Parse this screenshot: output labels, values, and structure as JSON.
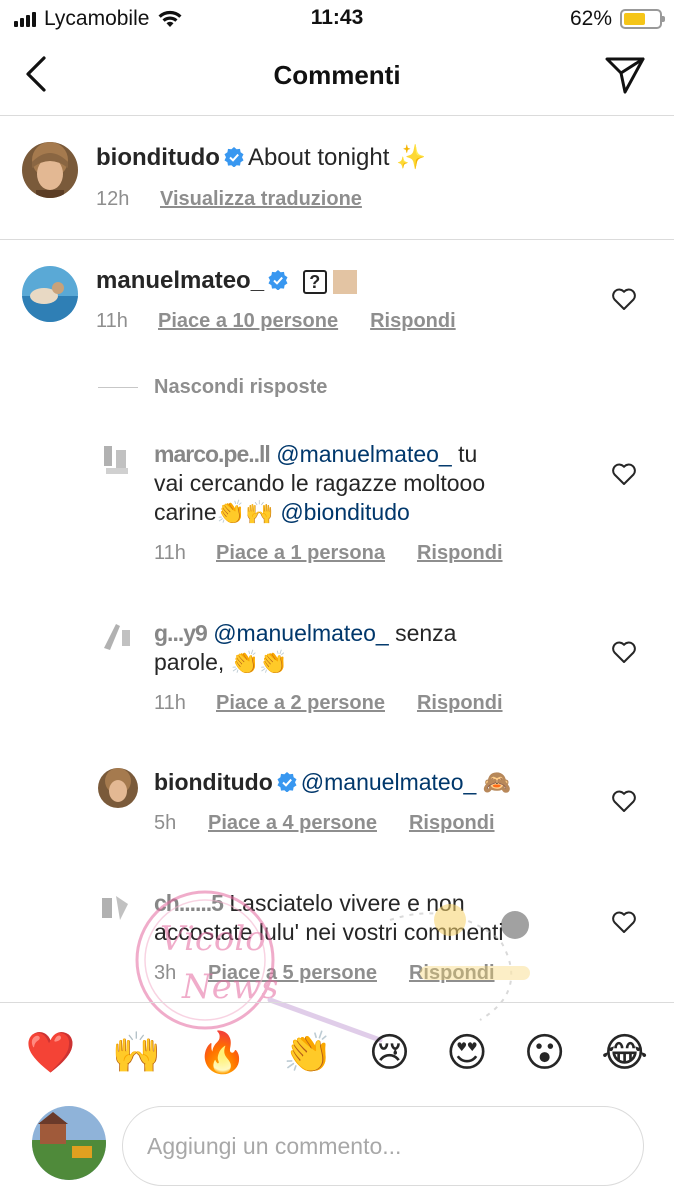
{
  "status_bar": {
    "carrier": "Lycamobile",
    "time": "11:43",
    "battery": "62%",
    "battery_level": 0.62
  },
  "header": {
    "title": "Commenti",
    "back_icon": "chevron-left-icon",
    "send_icon": "paper-plane-icon"
  },
  "caption": {
    "username": "bionditudo",
    "text": "About tonight ✨",
    "time": "12h",
    "translate_label": "Visualizza traduzione"
  },
  "comment": {
    "username": "manuelmateo_",
    "text": "❓",
    "time": "11h",
    "likes_label": "Piace a 10 persone",
    "reply_label": "Rispondi"
  },
  "hide_replies_label": "Nascondi risposte",
  "replies": [
    {
      "username_partial": "marco.pe..ll",
      "mention": "@manuelmateo_",
      "text1": " tu",
      "text2": "vai cercando le ragazze moltooo",
      "text3": "carine👏🙌 ",
      "mention2": "@bionditudo",
      "time": "11h",
      "likes_label": "Piace a 1 persona",
      "reply_label": "Rispondi"
    },
    {
      "username_partial": "g...y9",
      "mention": "@manuelmateo_",
      "text1": " senza",
      "text2": "parole, 👏👏",
      "time": "11h",
      "likes_label": "Piace a 2 persone",
      "reply_label": "Rispondi"
    },
    {
      "username": "bionditudo",
      "mention": "@manuelmateo_",
      "text1": " 🙈",
      "time": "5h",
      "likes_label": "Piace a 4 persone",
      "reply_label": "Rispondi"
    },
    {
      "username_partial": "ch......5",
      "text1": " Lasciatelo vivere e non",
      "text2": "accostate lulu' nei vostri commenti",
      "time": "3h",
      "likes_label": "Piace a 5 persone",
      "reply_label": "Rispondi"
    }
  ],
  "emoji_bar": [
    "❤️",
    "🙌",
    "🔥",
    "👏",
    "😢",
    "😍",
    "😮",
    "😂"
  ],
  "composer": {
    "placeholder": "Aggiungi un commento..."
  },
  "watermark_text": "Vicolo delle News"
}
